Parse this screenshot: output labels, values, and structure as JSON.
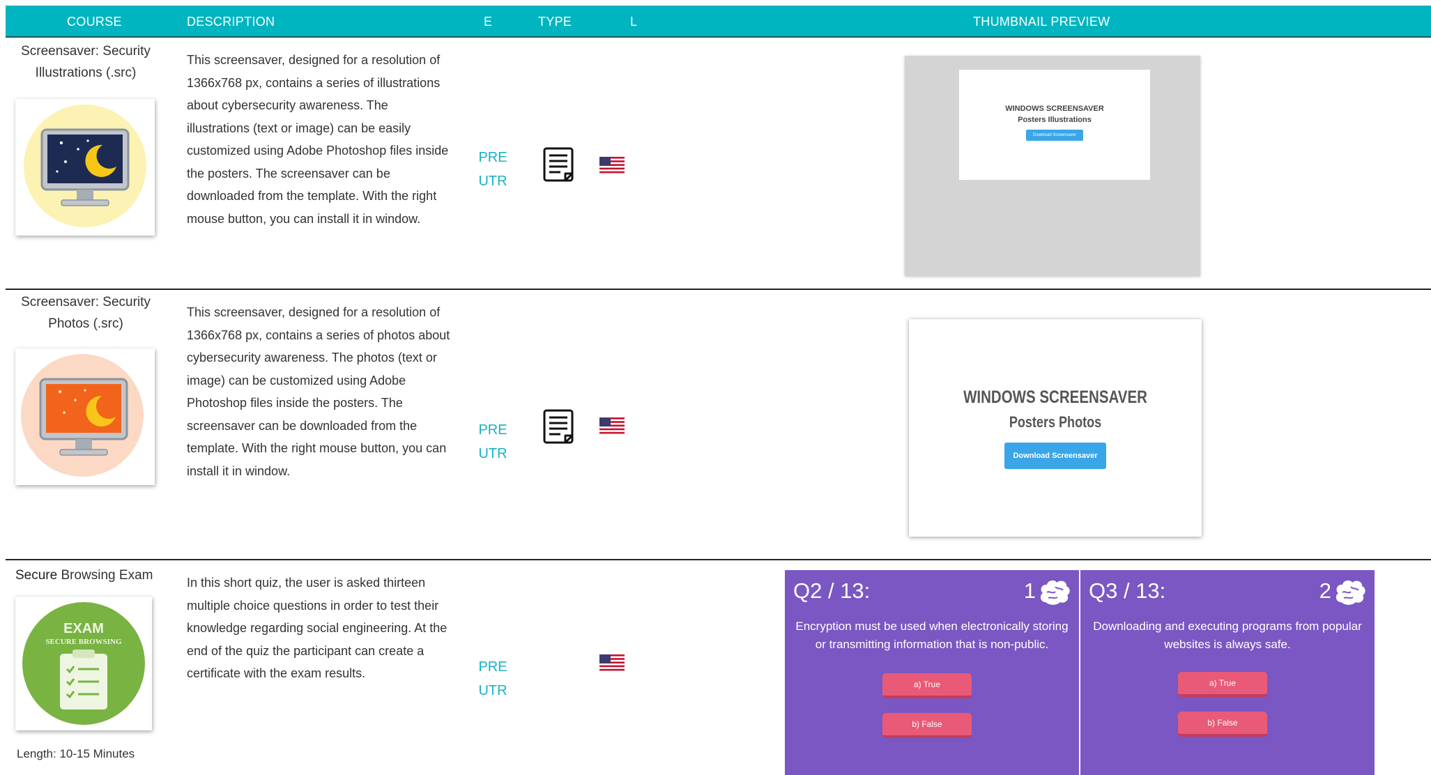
{
  "header": {
    "course": "COURSE",
    "description": "DESCRIPTION",
    "e": "E",
    "type": "TYPE",
    "l": "L",
    "thumbnail": "THUMBNAIL PREVIEW"
  },
  "colors": {
    "header_bg": "#00b5c0",
    "accent_text": "#19b3c0",
    "quiz_bg": "#7a57c2",
    "quiz_button": "#e85a77",
    "download_button": "#3aa6e8"
  },
  "rows": [
    {
      "course_title": "Screensaver: Security Illustrations (.src)",
      "course_icon": "monitor-night-moon-icon",
      "description": "This screensaver, designed for a resolution of 1366x768 px, contains a series of illustrations about cybersecurity awareness. The illustrations (text or image) can be easily customized using Adobe Photoshop files inside the posters. The screensaver can be downloaded from the template. With the right mouse button, you can install it in window.",
      "e_line1": "PRE",
      "e_line2": "UTR",
      "type_icon": "document-icon",
      "language_flag": "us-flag-icon",
      "thumbnail": {
        "title": "WINDOWS SCREENSAVER",
        "subtitle": "Posters Illustrations",
        "button": "Download Screensaver"
      }
    },
    {
      "course_title": "Screensaver: Security Photos (.src)",
      "course_icon": "monitor-orange-moon-icon",
      "description": "This screensaver, designed for a resolution of 1366x768 px, contains a series of photos about cybersecurity awareness. The photos (text or image) can be customized using Adobe Photoshop files inside the posters. The screensaver can be downloaded from the template. With the right mouse button, you can install it in window.",
      "e_line1": "PRE",
      "e_line2": "UTR",
      "type_icon": "document-icon",
      "language_flag": "us-flag-icon",
      "thumbnail": {
        "title": "WINDOWS SCREENSAVER",
        "subtitle": "Posters Photos",
        "button": "Download Screensaver"
      }
    },
    {
      "course_title_bold": "Secure",
      "course_title_rest": " Browsing Exam",
      "course_icon": "exam-clipboard-icon",
      "badge_line1": "EXAM",
      "badge_line2": "SECURE BROWSING",
      "length": "Length: 10-15 Minutes",
      "description": "In this short quiz, the user is asked thirteen multiple choice questions in order to test their knowledge regarding social engineering. At the end of the quiz the participant can create a certificate with the exam results.",
      "e_line1": "PRE",
      "e_line2": "UTR",
      "language_flag": "us-flag-icon",
      "quizzes": [
        {
          "question_number": "Q2 / 13:",
          "score": "1",
          "question": "Encryption must be used when electronically storing or transmitting information that is non-public.",
          "answer_a": "a) True",
          "answer_b": "b) False"
        },
        {
          "question_number": "Q3 / 13:",
          "score": "2",
          "question": "Downloading and executing programs from popular websites is always safe.",
          "answer_a": "a) True",
          "answer_b": "b) False"
        }
      ]
    }
  ]
}
